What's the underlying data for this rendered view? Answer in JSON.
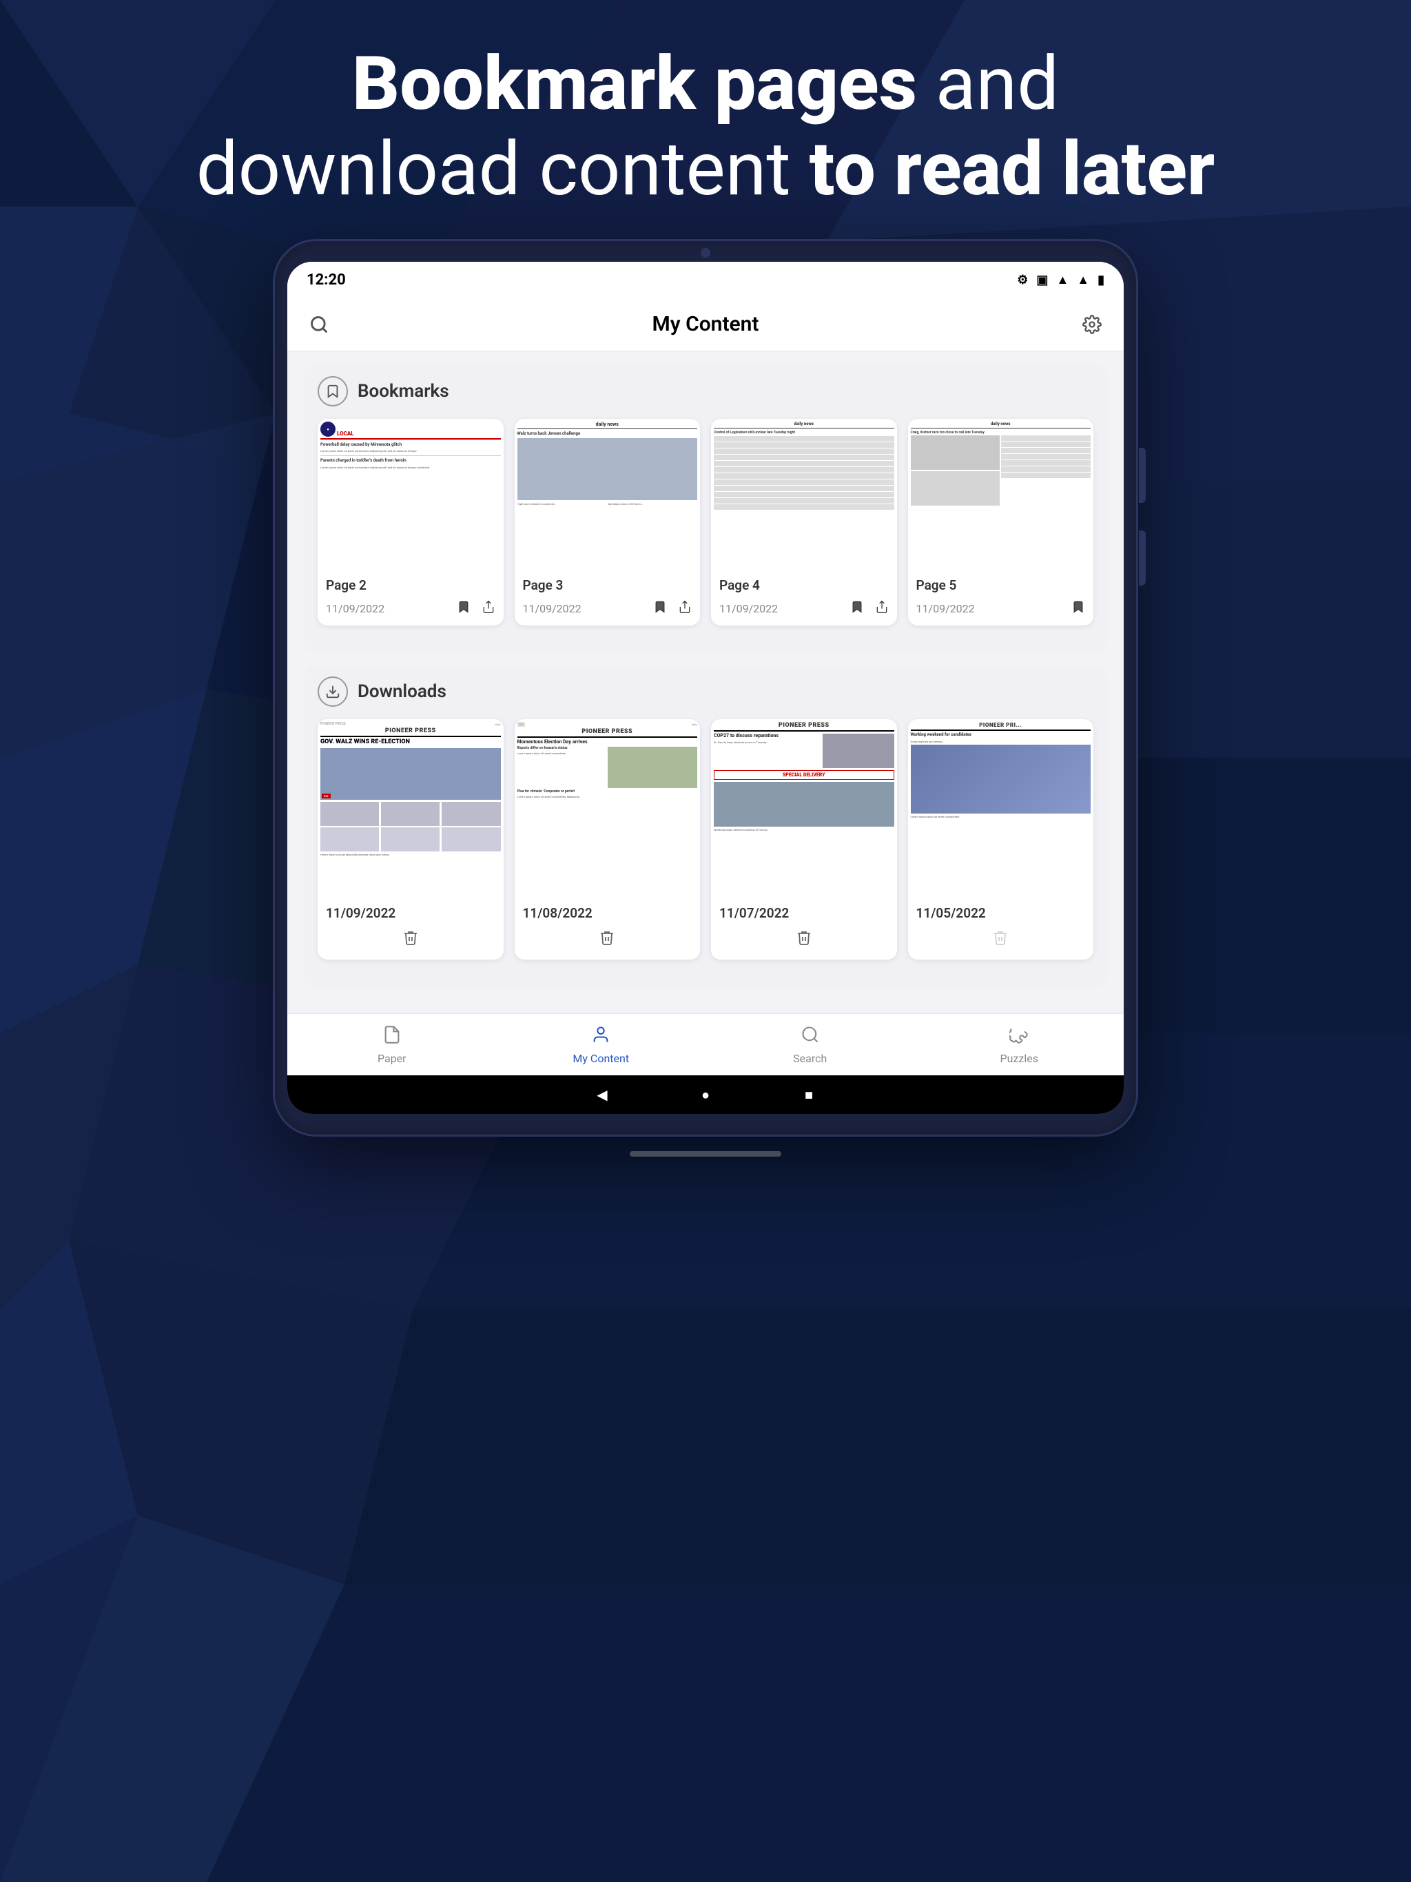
{
  "hero": {
    "line1_bold": "Bookmark pages",
    "line1_normal": " and",
    "line2_normal": "download content",
    "line2_bold": " to read later"
  },
  "status_bar": {
    "time": "12:20",
    "wifi_icon": "▲",
    "battery_icon": "▮"
  },
  "top_bar": {
    "title": "My Content",
    "search_label": "Search",
    "settings_label": "Settings"
  },
  "bookmarks_section": {
    "title": "Bookmarks",
    "icon": "🔖",
    "cards": [
      {
        "label": "Page 2",
        "date": "11/09/2022"
      },
      {
        "label": "Page 3",
        "date": "11/09/2022"
      },
      {
        "label": "Page 4",
        "date": "11/09/2022"
      },
      {
        "label": "Page 5",
        "date": "11/09/2022"
      }
    ]
  },
  "downloads_section": {
    "title": "Downloads",
    "icon": "⬇",
    "cards": [
      {
        "date": "11/09/2022",
        "headline": "GOV. WALZ WINS RE-ELECTION"
      },
      {
        "date": "11/08/2022",
        "headline": "Momentous Election Day arrives"
      },
      {
        "date": "11/07/2022",
        "headline": "COP27 to discuss reparations"
      },
      {
        "date": "11/05/2022",
        "headline": "Working weekend for candidates"
      }
    ]
  },
  "bottom_nav": {
    "items": [
      {
        "label": "Paper",
        "icon": "📄",
        "active": false
      },
      {
        "label": "My Content",
        "icon": "👤",
        "active": true
      },
      {
        "label": "Search",
        "icon": "🔍",
        "active": false
      },
      {
        "label": "Puzzles",
        "icon": "🧩",
        "active": false
      }
    ]
  },
  "android_nav": {
    "back": "◀",
    "home": "●",
    "recent": "■"
  },
  "colors": {
    "active_nav": "#2655c0",
    "background": "#0d1f4e",
    "accent_red": "#cc0000"
  }
}
